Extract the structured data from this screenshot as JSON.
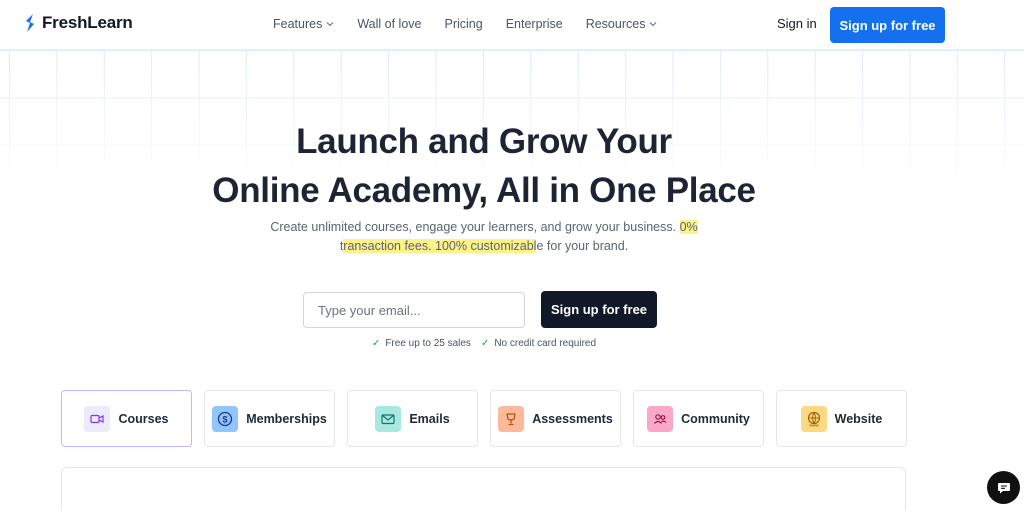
{
  "header": {
    "brand": "FreshLearn",
    "nav": [
      {
        "label": "Features",
        "dropdown": true
      },
      {
        "label": "Wall of love",
        "dropdown": false
      },
      {
        "label": "Pricing",
        "dropdown": false
      },
      {
        "label": "Enterprise",
        "dropdown": false
      },
      {
        "label": "Resources",
        "dropdown": true
      }
    ],
    "signin_label": "Sign in",
    "signup_label": "Sign up for free"
  },
  "hero": {
    "title_line1": "Launch and Grow Your",
    "title_line2": "Online Academy, All in One Place",
    "sub_part1": "Create unlimited courses, engage your learners, and grow your business. ",
    "sub_hl1": "0%",
    "sub_part2": "t",
    "sub_hl2": "ransaction fees. 100% customizabl",
    "sub_part3": "e for your brand.",
    "email_placeholder": "Type your email...",
    "email_value": "",
    "cta_label": "Sign up for free",
    "perks": [
      "Free up to 25 sales",
      "No credit card required"
    ]
  },
  "tabs": [
    {
      "label": "Courses",
      "icon": "video-icon",
      "active": true
    },
    {
      "label": "Memberships",
      "icon": "dollar-coin-icon",
      "active": false
    },
    {
      "label": "Emails",
      "icon": "mail-icon",
      "active": false
    },
    {
      "label": "Assessments",
      "icon": "trophy-icon",
      "active": false
    },
    {
      "label": "Community",
      "icon": "people-icon",
      "active": false
    },
    {
      "label": "Website",
      "icon": "globe-icon",
      "active": false
    }
  ],
  "colors": {
    "primary": "#1570ef",
    "dark": "#111827",
    "highlight": "#fdf18a",
    "check": "#16a34a",
    "active_tab_border": "#c4b5fd"
  }
}
